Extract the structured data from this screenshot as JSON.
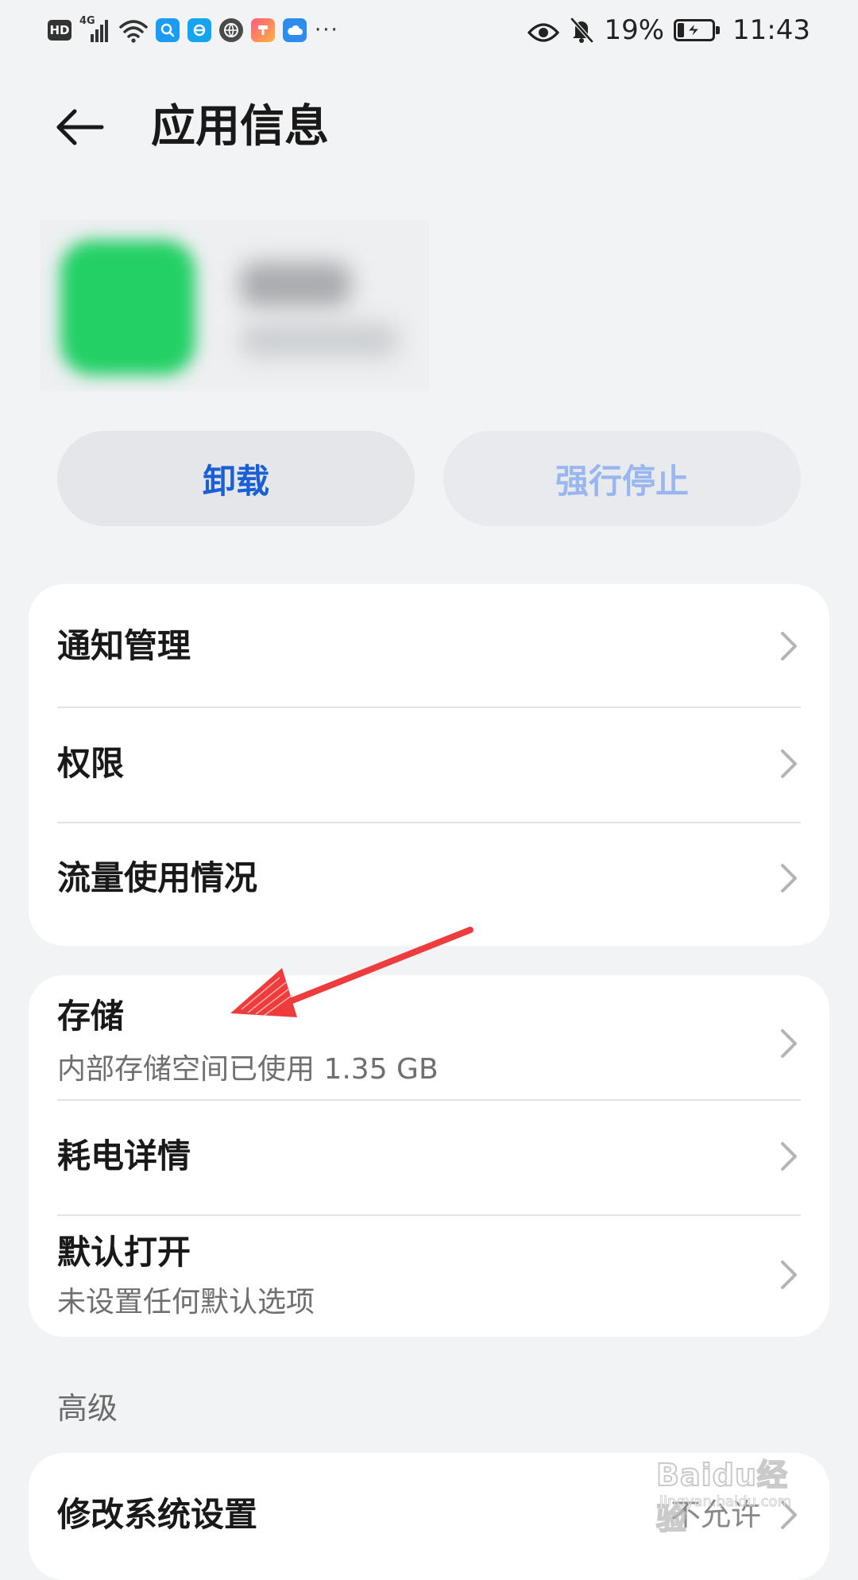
{
  "status_bar": {
    "network_type": "4G",
    "hd_badge": "HD",
    "overflow_indicator": "···",
    "battery_percent": "19%",
    "battery_level": 0.19,
    "time": "11:43"
  },
  "header": {
    "title": "应用信息"
  },
  "actions": {
    "uninstall_label": "卸载",
    "force_stop_label": "强行停止"
  },
  "group_1": {
    "notifications": "通知管理",
    "permissions": "权限",
    "data_usage": "流量使用情况"
  },
  "group_2": {
    "storage": "存储",
    "storage_sub": "内部存储空间已使用 1.35 GB",
    "battery_usage": "耗电详情",
    "open_by_default": "默认打开",
    "open_by_default_sub": "未设置任何默认选项"
  },
  "advanced": {
    "section_label": "高级",
    "modify_system_settings": "修改系统设置",
    "modify_system_settings_value": "不允许"
  },
  "watermark": {
    "logo": "Baidu经验",
    "url": "jingyan.baidu.com"
  },
  "colors": {
    "background": "#f1f3f5",
    "accent_blue": "#1a5fd6",
    "disabled_blue": "#99b7ee",
    "annotation_red": "#ee3b3b"
  }
}
